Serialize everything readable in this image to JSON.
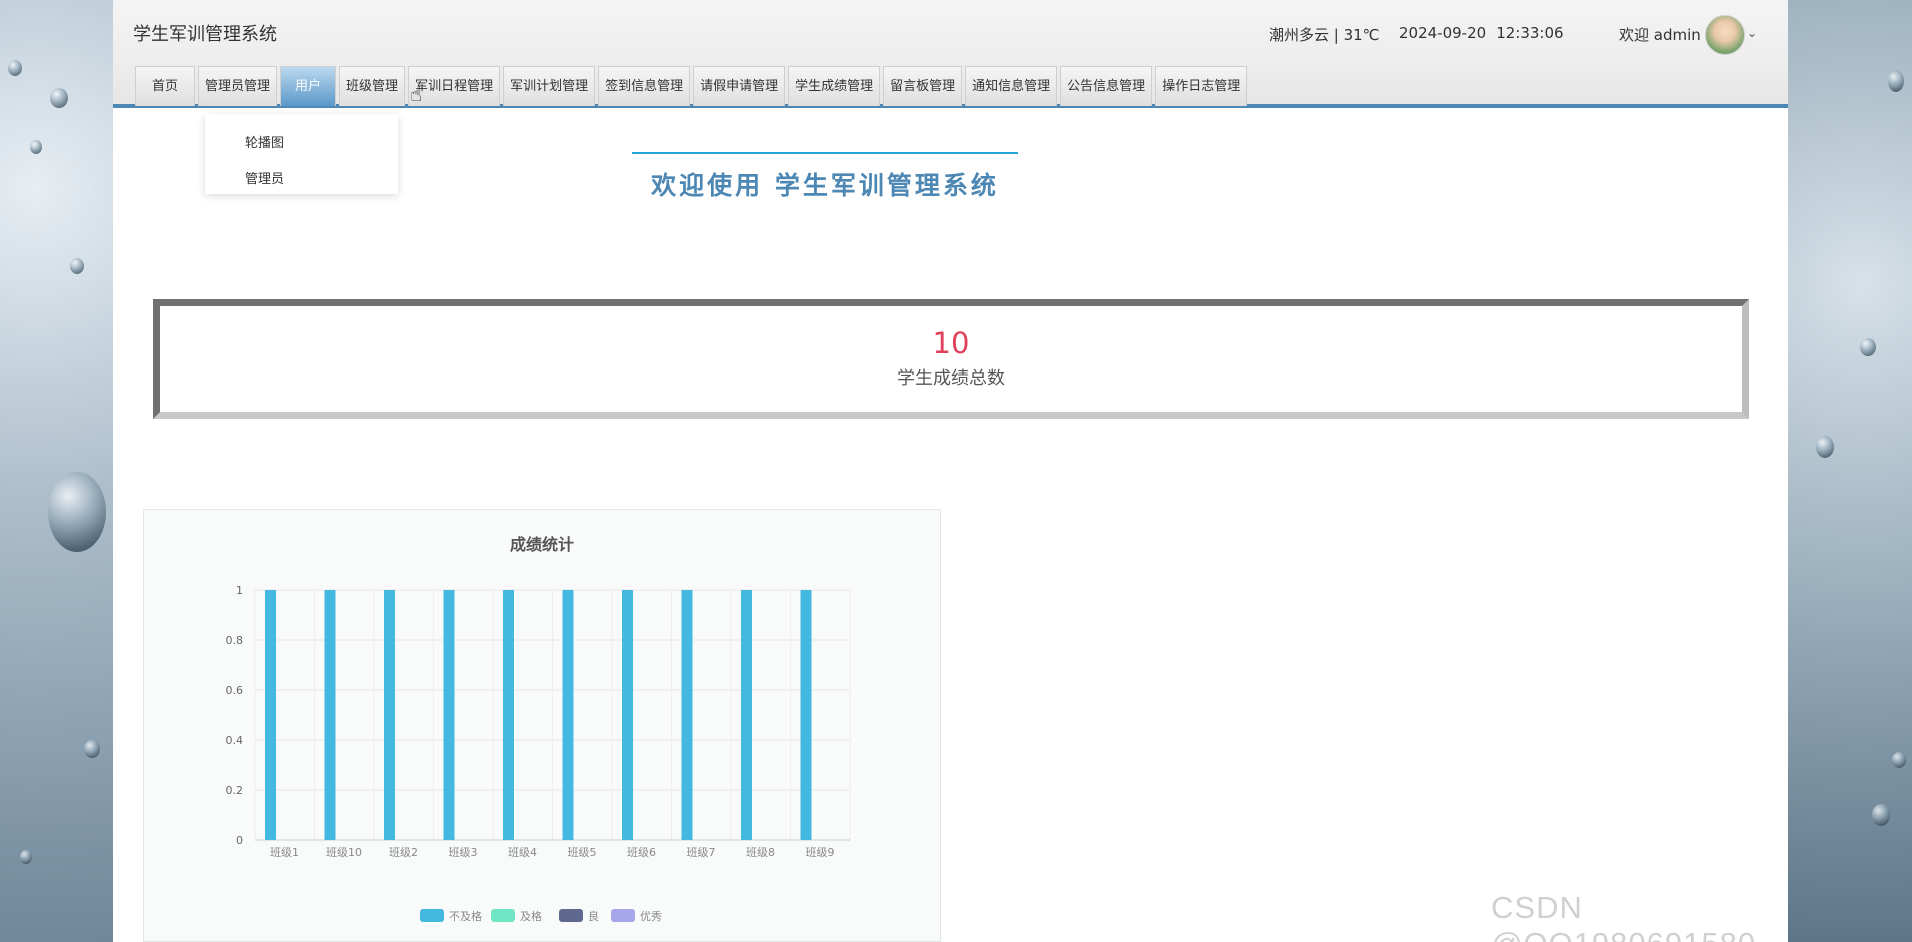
{
  "app": {
    "title": "学生军训管理系统"
  },
  "header": {
    "weather": "潮州多云 | 31℃",
    "date": "2024-09-20",
    "time": "12:33:06",
    "welcome": "欢迎 admin"
  },
  "nav": {
    "items": [
      {
        "label": "首页"
      },
      {
        "label": "管理员管理"
      },
      {
        "label": "用户"
      },
      {
        "label": "班级管理"
      },
      {
        "label": "军训日程管理"
      },
      {
        "label": "军训计划管理"
      },
      {
        "label": "签到信息管理"
      },
      {
        "label": "请假申请管理"
      },
      {
        "label": "学生成绩管理"
      },
      {
        "label": "留言板管理"
      },
      {
        "label": "通知信息管理"
      },
      {
        "label": "公告信息管理"
      },
      {
        "label": "操作日志管理"
      }
    ],
    "active_index": 2
  },
  "dropdown": {
    "items": [
      "轮播图",
      "管理员"
    ]
  },
  "banner": {
    "text": "欢迎使用 学生军训管理系统"
  },
  "stat": {
    "value": "10",
    "label": "学生成绩总数"
  },
  "colors": {
    "accent": "#4d87b3",
    "stat_value": "#e0425c"
  },
  "chart_data": {
    "type": "bar",
    "title": "成绩统计",
    "categories": [
      "班级1",
      "班级10",
      "班级2",
      "班级3",
      "班级4",
      "班级5",
      "班级6",
      "班级7",
      "班级8",
      "班级9"
    ],
    "series": [
      {
        "name": "不及格",
        "color": "#44b8e0",
        "values": [
          1,
          1,
          1,
          1,
          1,
          1,
          1,
          1,
          1,
          1
        ]
      },
      {
        "name": "及格",
        "color": "#71e6c4",
        "values": [
          0,
          0,
          0,
          0,
          0,
          0,
          0,
          0,
          0,
          0
        ]
      },
      {
        "name": "良",
        "color": "#5f6990",
        "values": [
          0,
          0,
          0,
          0,
          0,
          0,
          0,
          0,
          0,
          0
        ]
      },
      {
        "name": "优秀",
        "color": "#a7a6ea",
        "values": [
          0,
          0,
          0,
          0,
          0,
          0,
          0,
          0,
          0,
          0
        ]
      }
    ],
    "yticks": [
      "0",
      "0.2",
      "0.4",
      "0.6",
      "0.8",
      "1"
    ],
    "ylim": [
      0,
      1
    ],
    "grid": true,
    "legend": "bottom"
  },
  "watermark": "CSDN @QQ1980691580"
}
